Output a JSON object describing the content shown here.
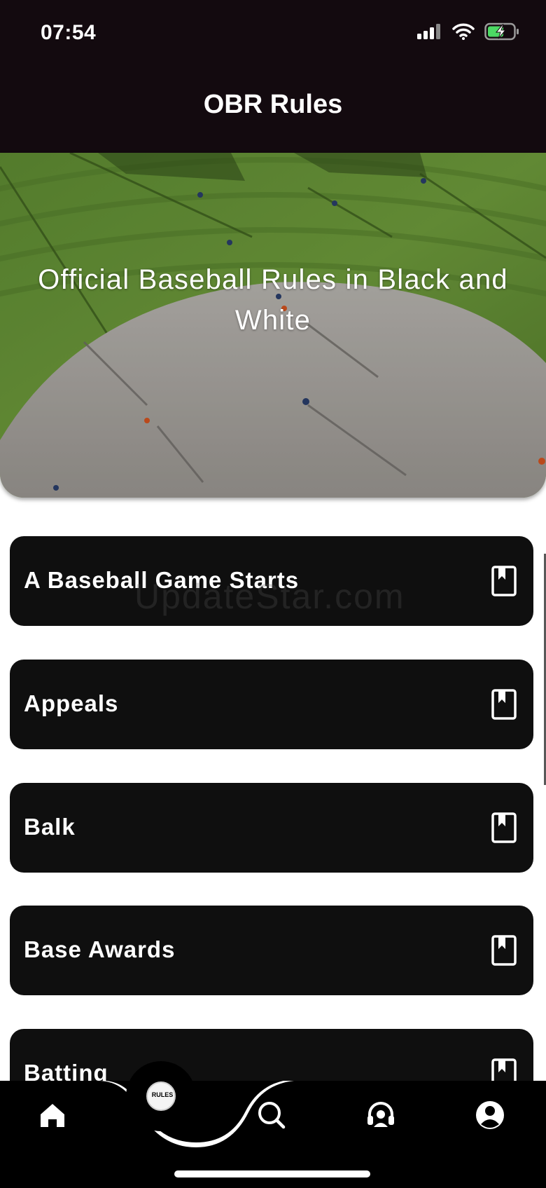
{
  "status_bar": {
    "time": "07:54"
  },
  "header": {
    "title": "OBR Rules"
  },
  "hero": {
    "headline": "Official Baseball Rules in Black and White"
  },
  "rules": [
    {
      "label": "A Baseball Game Starts"
    },
    {
      "label": "Appeals"
    },
    {
      "label": "Balk"
    },
    {
      "label": "Base Awards"
    },
    {
      "label": "Batting"
    }
  ],
  "watermark": {
    "text": "UpdateStar.com"
  },
  "bottom_nav": {
    "fab_label": "RULES",
    "items": [
      {
        "icon": "home-icon"
      },
      {
        "icon": "rules-fab-icon"
      },
      {
        "icon": "search-icon"
      },
      {
        "icon": "headset-icon"
      },
      {
        "icon": "profile-icon"
      }
    ]
  },
  "colors": {
    "header_bg": "#130a0f",
    "card_bg": "#0f0f0f",
    "nav_bg": "#000000"
  }
}
